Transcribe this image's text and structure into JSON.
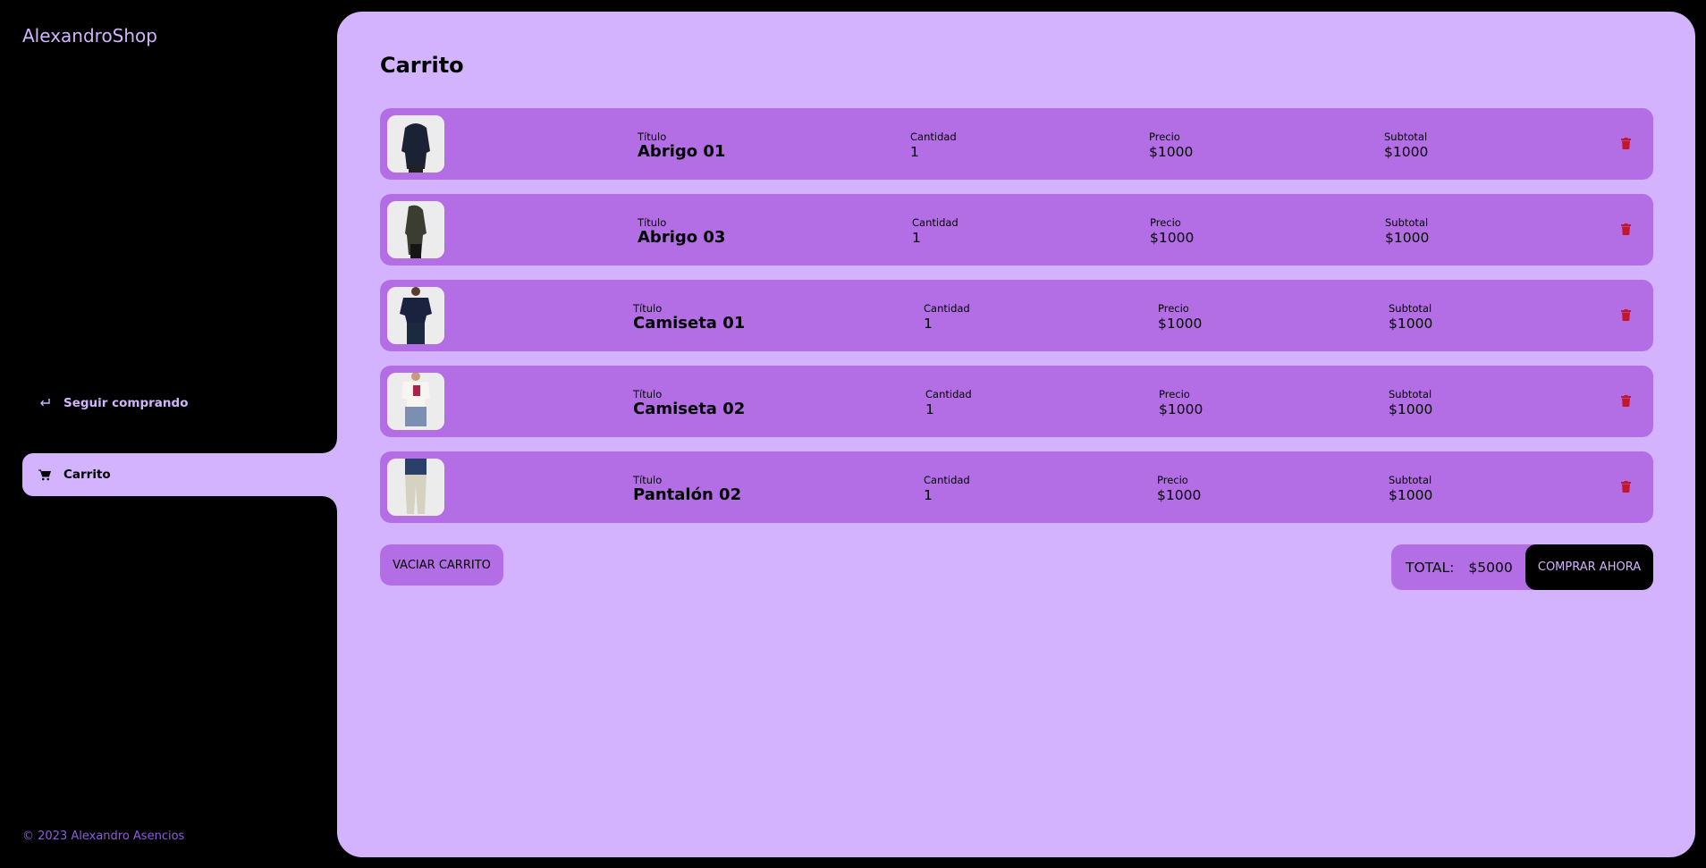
{
  "sidebar": {
    "logo": "AlexandroShop",
    "nav": [
      {
        "label": "Seguir comprando",
        "icon": "return-icon"
      },
      {
        "label": "Carrito",
        "icon": "cart-icon",
        "active": true
      }
    ],
    "footer": "© 2023 Alexandro Asencios"
  },
  "main": {
    "title": "Carrito",
    "labels": {
      "title": "Título",
      "qty": "Cantidad",
      "price": "Precio",
      "subtotal": "Subtotal"
    },
    "items": [
      {
        "title": "Abrigo 01",
        "qty": "1",
        "price": "$1000",
        "subtotal": "$1000"
      },
      {
        "title": "Abrigo 03",
        "qty": "1",
        "price": "$1000",
        "subtotal": "$1000"
      },
      {
        "title": "Camiseta 01",
        "qty": "1",
        "price": "$1000",
        "subtotal": "$1000"
      },
      {
        "title": "Camiseta 02",
        "qty": "1",
        "price": "$1000",
        "subtotal": "$1000"
      },
      {
        "title": "Pantalón 02",
        "qty": "1",
        "price": "$1000",
        "subtotal": "$1000"
      }
    ],
    "empty_button": "VACIAR CARRITO",
    "total_label": "TOTAL:",
    "total_value": "$5000",
    "buy_button": "COMPRAR AHORA"
  },
  "colors": {
    "accent": "#d3b3fd",
    "row": "#b46ee5",
    "trash": "#c2162c"
  }
}
